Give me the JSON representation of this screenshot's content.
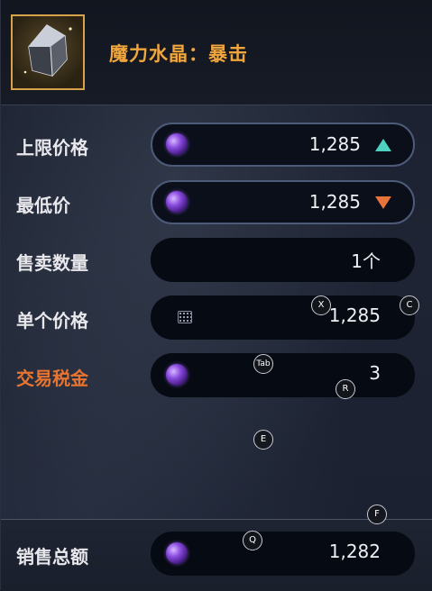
{
  "item": {
    "name": "魔力水晶：暴击",
    "icon": "crystal-icon"
  },
  "rows": [
    {
      "label": "上限价格",
      "value": "1,285",
      "currency_icon": "gem-icon",
      "trend": "up",
      "trend_color": "#4fd1c1"
    },
    {
      "label": "最低价",
      "value": "1,285",
      "currency_icon": "gem-icon",
      "trend": "down",
      "trend_color": "#e8743c"
    },
    {
      "label": "售卖数量",
      "value": "1个"
    },
    {
      "label": "单个价格",
      "value": "1,285",
      "input_icon": "keypad-icon"
    },
    {
      "label": "交易税金",
      "value": "3",
      "currency_icon": "gem-icon",
      "label_color": "#e8742f"
    }
  ],
  "total": {
    "label": "销售总额",
    "value": "1,282",
    "currency_icon": "gem-icon"
  },
  "key_hints": {
    "x": "X",
    "c": "C",
    "tab": "Tab",
    "r": "R",
    "e": "E",
    "f": "F",
    "q": "Q"
  },
  "colors": {
    "title": "#f0a63c",
    "tax_label": "#e8742f",
    "up_arrow": "#4fd1c1",
    "down_arrow": "#e8743c",
    "gem": "#8a4be0",
    "item_frame": "#d7a24a"
  }
}
